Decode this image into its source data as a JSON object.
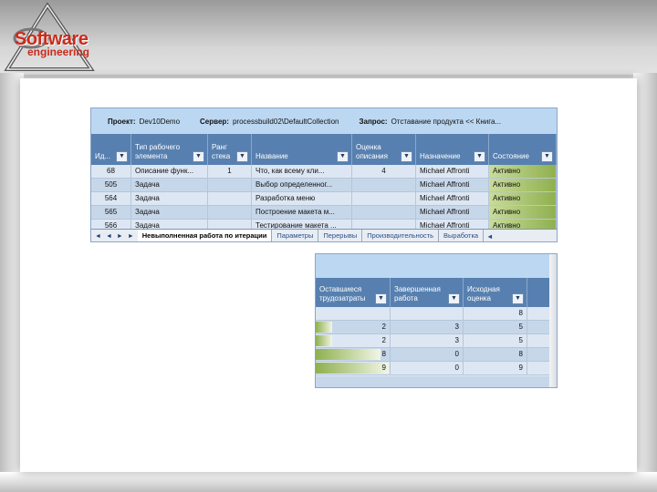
{
  "branding": {
    "logo_line1": "Software",
    "logo_line2": "engineering"
  },
  "query_bar": {
    "project_label": "Проект:",
    "project_value": "Dev10Demo",
    "server_label": "Сервер:",
    "server_value": "processbuild02\\DefaultCollection",
    "query_label": "Запрос:",
    "query_value": "Отставание продукта << Книга..."
  },
  "grid1": {
    "columns": [
      {
        "label": "Ид...",
        "w": 44
      },
      {
        "label": "Тип рабочего элемента",
        "w": 84
      },
      {
        "label": "Ранг стека",
        "w": 48
      },
      {
        "label": "Название",
        "w": 110
      },
      {
        "label": "Оценка описания",
        "w": 70
      },
      {
        "label": "Назначение",
        "w": 80
      },
      {
        "label": "Состояние",
        "w": 74
      }
    ],
    "rows": [
      [
        "68",
        "Описание функ...",
        "1",
        "Что, как всему кли...",
        "4",
        "Michael Affronti",
        "Активно"
      ],
      [
        "505",
        "Задача",
        "",
        "Выбор определенног...",
        "",
        "Michael Affronti",
        "Активно"
      ],
      [
        "564",
        "Задача",
        "",
        "Разработка меню",
        "",
        "Michael Affronti",
        "Активно"
      ],
      [
        "565",
        "Задача",
        "",
        "Построение макета м...",
        "",
        "Michael Affronti",
        "Активно"
      ],
      [
        "566",
        "Задача",
        "",
        "Тестирование макета ...",
        "",
        "Michael Affronti",
        "Активно"
      ]
    ]
  },
  "sheet_tabs": {
    "nav": [
      "◄",
      "◄",
      "►",
      "►"
    ],
    "tabs": [
      "Невыполненная работа по итерации",
      "Параметры",
      "Перерывы",
      "Производительность",
      "Выработка"
    ],
    "active_index": 0,
    "end_symbol": "◄"
  },
  "grid2": {
    "columns": [
      {
        "label": "Оставшиеся трудозатраты",
        "w": 82
      },
      {
        "label": "Завершенная работа",
        "w": 80
      },
      {
        "label": "Исходная оценка",
        "w": 70
      }
    ],
    "rows": [
      {
        "remaining": "",
        "completed": "",
        "original": "8",
        "bar": 0
      },
      {
        "remaining": "2",
        "completed": "3",
        "original": "5",
        "bar": 0.22
      },
      {
        "remaining": "2",
        "completed": "3",
        "original": "5",
        "bar": 0.22
      },
      {
        "remaining": "8",
        "completed": "0",
        "original": "8",
        "bar": 0.89
      },
      {
        "remaining": "9",
        "completed": "0",
        "original": "9",
        "bar": 1.0
      }
    ],
    "bar_max_value": 9
  }
}
